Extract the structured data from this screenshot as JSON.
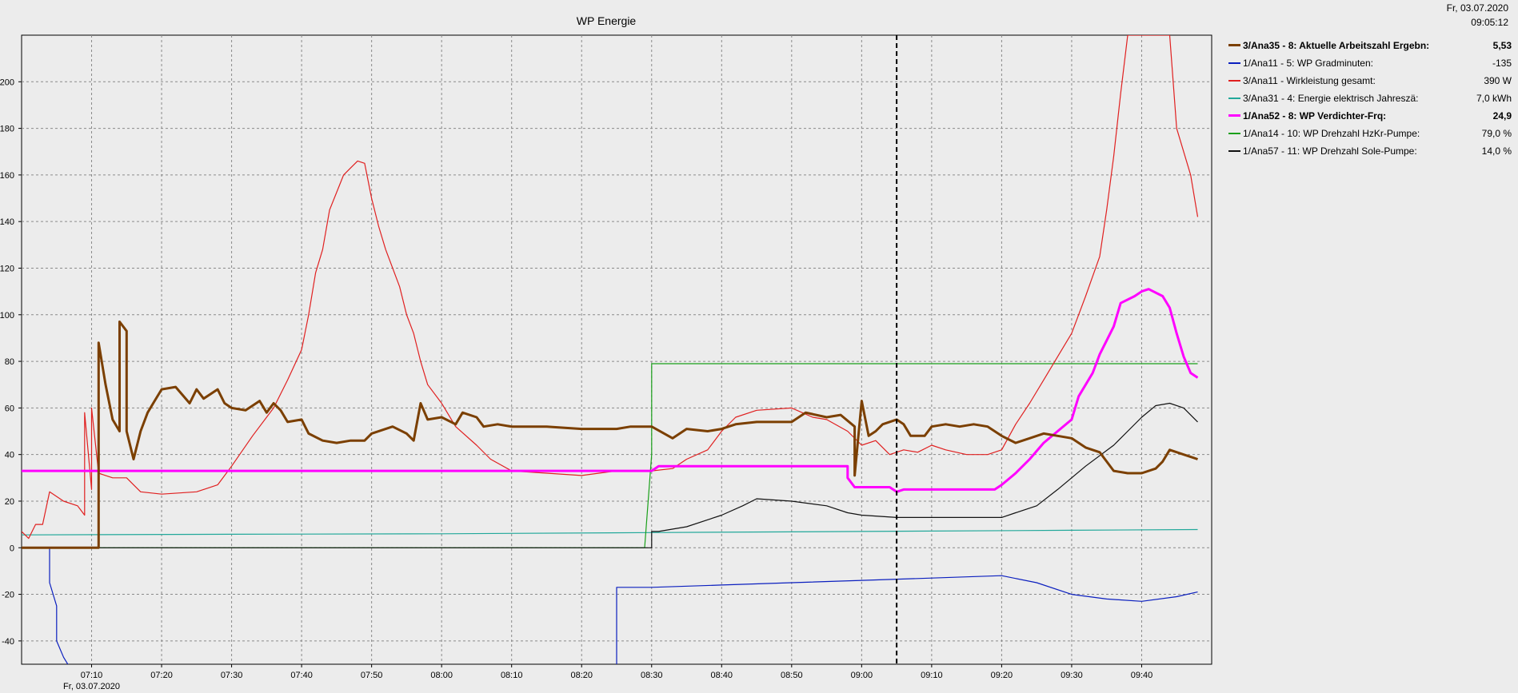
{
  "header": {
    "date": "Fr, 03.07.2020",
    "time": "09:05:12"
  },
  "chart_data": {
    "type": "line",
    "title": "WP Energie",
    "xlabel": "",
    "ylabel": "",
    "ylim": [
      -50,
      220
    ],
    "xlim": [
      "07:00",
      "09:50"
    ],
    "x_ticks": [
      "07:10",
      "07:20",
      "07:30",
      "07:40",
      "07:50",
      "08:00",
      "08:10",
      "08:20",
      "08:30",
      "08:40",
      "08:50",
      "09:00",
      "09:10",
      "09:20",
      "09:30",
      "09:40"
    ],
    "x_date_label": "Fr, 03.07.2020",
    "y_ticks": [
      -40,
      -20,
      0,
      20,
      40,
      60,
      80,
      100,
      120,
      140,
      160,
      180,
      200
    ],
    "grid": true,
    "legend_position": "right",
    "cursor_time": "09:05",
    "series": [
      {
        "name": "3/Ana35 - 8: Aktuelle Arbeitszahl Ergebn:",
        "value": "5,53",
        "color": "#7b3f00",
        "bold": true,
        "points": [
          [
            "07:00",
            0
          ],
          [
            "07:10",
            0
          ],
          [
            "07:11",
            0
          ],
          [
            "07:11",
            88
          ],
          [
            "07:12",
            70
          ],
          [
            "07:13",
            55
          ],
          [
            "07:14",
            50
          ],
          [
            "07:14",
            97
          ],
          [
            "07:15",
            93
          ],
          [
            "07:15",
            50
          ],
          [
            "07:16",
            38
          ],
          [
            "07:17",
            50
          ],
          [
            "07:18",
            58
          ],
          [
            "07:19",
            63
          ],
          [
            "07:20",
            68
          ],
          [
            "07:22",
            69
          ],
          [
            "07:24",
            62
          ],
          [
            "07:25",
            68
          ],
          [
            "07:26",
            64
          ],
          [
            "07:28",
            68
          ],
          [
            "07:29",
            62
          ],
          [
            "07:30",
            60
          ],
          [
            "07:32",
            59
          ],
          [
            "07:34",
            63
          ],
          [
            "07:35",
            58
          ],
          [
            "07:36",
            62
          ],
          [
            "07:37",
            59
          ],
          [
            "07:38",
            54
          ],
          [
            "07:40",
            55
          ],
          [
            "07:41",
            49
          ],
          [
            "07:43",
            46
          ],
          [
            "07:45",
            45
          ],
          [
            "07:47",
            46
          ],
          [
            "07:49",
            46
          ],
          [
            "07:50",
            49
          ],
          [
            "07:53",
            52
          ],
          [
            "07:55",
            49
          ],
          [
            "07:56",
            46
          ],
          [
            "07:57",
            62
          ],
          [
            "07:58",
            55
          ],
          [
            "08:00",
            56
          ],
          [
            "08:02",
            53
          ],
          [
            "08:03",
            58
          ],
          [
            "08:05",
            56
          ],
          [
            "08:06",
            52
          ],
          [
            "08:08",
            53
          ],
          [
            "08:10",
            52
          ],
          [
            "08:15",
            52
          ],
          [
            "08:20",
            51
          ],
          [
            "08:25",
            51
          ],
          [
            "08:27",
            52
          ],
          [
            "08:30",
            52
          ],
          [
            "08:33",
            47
          ],
          [
            "08:35",
            51
          ],
          [
            "08:38",
            50
          ],
          [
            "08:40",
            51
          ],
          [
            "08:42",
            53
          ],
          [
            "08:45",
            54
          ],
          [
            "08:48",
            54
          ],
          [
            "08:50",
            54
          ],
          [
            "08:52",
            58
          ],
          [
            "08:55",
            56
          ],
          [
            "08:57",
            57
          ],
          [
            "08:59",
            52
          ],
          [
            "08:59",
            31
          ],
          [
            "09:00",
            63
          ],
          [
            "09:01",
            48
          ],
          [
            "09:02",
            50
          ],
          [
            "09:03",
            53
          ],
          [
            "09:05",
            55
          ],
          [
            "09:06",
            53
          ],
          [
            "09:07",
            48
          ],
          [
            "09:09",
            48
          ],
          [
            "09:10",
            52
          ],
          [
            "09:12",
            53
          ],
          [
            "09:14",
            52
          ],
          [
            "09:16",
            53
          ],
          [
            "09:18",
            52
          ],
          [
            "09:20",
            48
          ],
          [
            "09:22",
            45
          ],
          [
            "09:24",
            47
          ],
          [
            "09:26",
            49
          ],
          [
            "09:28",
            48
          ],
          [
            "09:30",
            47
          ],
          [
            "09:32",
            43
          ],
          [
            "09:34",
            41
          ],
          [
            "09:35",
            37
          ],
          [
            "09:36",
            33
          ],
          [
            "09:38",
            32
          ],
          [
            "09:40",
            32
          ],
          [
            "09:42",
            34
          ],
          [
            "09:43",
            37
          ],
          [
            "09:44",
            42
          ],
          [
            "09:46",
            40
          ],
          [
            "09:47",
            39
          ],
          [
            "09:48",
            38
          ]
        ]
      },
      {
        "name": "1/Ana11 - 5: WP Gradminuten:",
        "value": "-135",
        "color": "#0b1fbf",
        "bold": false,
        "points": [
          [
            "07:00",
            0
          ],
          [
            "07:04",
            0
          ],
          [
            "07:04",
            -15
          ],
          [
            "07:05",
            -25
          ],
          [
            "07:05",
            -40
          ],
          [
            "07:06",
            -47
          ],
          [
            "07:07",
            -52
          ],
          [
            "08:25",
            -52
          ],
          [
            "08:25",
            -17
          ],
          [
            "08:30",
            -17
          ],
          [
            "08:40",
            -16
          ],
          [
            "08:50",
            -15
          ],
          [
            "09:00",
            -14
          ],
          [
            "09:10",
            -13
          ],
          [
            "09:20",
            -12
          ],
          [
            "09:25",
            -15
          ],
          [
            "09:30",
            -20
          ],
          [
            "09:35",
            -22
          ],
          [
            "09:40",
            -23
          ],
          [
            "09:45",
            -21
          ],
          [
            "09:48",
            -19
          ]
        ]
      },
      {
        "name": "3/Ana11 - Wirkleistung gesamt:",
        "value": "390 W",
        "color": "#e02020",
        "bold": false,
        "points": [
          [
            "07:00",
            7
          ],
          [
            "07:01",
            4
          ],
          [
            "07:02",
            10
          ],
          [
            "07:03",
            10
          ],
          [
            "07:04",
            24
          ],
          [
            "07:06",
            20
          ],
          [
            "07:08",
            18
          ],
          [
            "07:09",
            14
          ],
          [
            "07:09",
            58
          ],
          [
            "07:10",
            25
          ],
          [
            "07:10",
            60
          ],
          [
            "07:11",
            32
          ],
          [
            "07:13",
            30
          ],
          [
            "07:15",
            30
          ],
          [
            "07:16",
            27
          ],
          [
            "07:17",
            24
          ],
          [
            "07:20",
            23
          ],
          [
            "07:25",
            24
          ],
          [
            "07:28",
            27
          ],
          [
            "07:30",
            35
          ],
          [
            "07:33",
            48
          ],
          [
            "07:36",
            60
          ],
          [
            "07:38",
            72
          ],
          [
            "07:40",
            85
          ],
          [
            "07:41",
            100
          ],
          [
            "07:42",
            118
          ],
          [
            "07:43",
            128
          ],
          [
            "07:44",
            145
          ],
          [
            "07:46",
            160
          ],
          [
            "07:47",
            163
          ],
          [
            "07:48",
            166
          ],
          [
            "07:49",
            165
          ],
          [
            "07:50",
            150
          ],
          [
            "07:51",
            138
          ],
          [
            "07:52",
            128
          ],
          [
            "07:54",
            112
          ],
          [
            "07:55",
            100
          ],
          [
            "07:56",
            92
          ],
          [
            "07:57",
            80
          ],
          [
            "07:58",
            70
          ],
          [
            "08:00",
            62
          ],
          [
            "08:02",
            52
          ],
          [
            "08:05",
            44
          ],
          [
            "08:07",
            38
          ],
          [
            "08:10",
            33
          ],
          [
            "08:15",
            32
          ],
          [
            "08:20",
            31
          ],
          [
            "08:25",
            33
          ],
          [
            "08:30",
            33
          ],
          [
            "08:33",
            34
          ],
          [
            "08:35",
            38
          ],
          [
            "08:38",
            42
          ],
          [
            "08:40",
            50
          ],
          [
            "08:42",
            56
          ],
          [
            "08:45",
            59
          ],
          [
            "08:50",
            60
          ],
          [
            "08:53",
            56
          ],
          [
            "08:55",
            55
          ],
          [
            "08:58",
            50
          ],
          [
            "09:00",
            44
          ],
          [
            "09:02",
            46
          ],
          [
            "09:04",
            40
          ],
          [
            "09:06",
            42
          ],
          [
            "09:08",
            41
          ],
          [
            "09:10",
            44
          ],
          [
            "09:12",
            42
          ],
          [
            "09:15",
            40
          ],
          [
            "09:18",
            40
          ],
          [
            "09:20",
            42
          ],
          [
            "09:22",
            53
          ],
          [
            "09:24",
            62
          ],
          [
            "09:26",
            72
          ],
          [
            "09:28",
            82
          ],
          [
            "09:30",
            92
          ],
          [
            "09:32",
            108
          ],
          [
            "09:34",
            125
          ],
          [
            "09:35",
            145
          ],
          [
            "09:36",
            168
          ],
          [
            "09:37",
            195
          ],
          [
            "09:38",
            220
          ],
          [
            "09:44",
            220
          ],
          [
            "09:45",
            180
          ],
          [
            "09:47",
            160
          ],
          [
            "09:48",
            142
          ]
        ]
      },
      {
        "name": "3/Ana31 - 4: Energie elektrisch Jahreszä:",
        "value": "7,0 kWh",
        "color": "#22a89a",
        "bold": false,
        "points": [
          [
            "07:00",
            5.5
          ],
          [
            "07:30",
            5.8
          ],
          [
            "08:00",
            6.0
          ],
          [
            "08:30",
            6.5
          ],
          [
            "09:00",
            7.0
          ],
          [
            "09:30",
            7.5
          ],
          [
            "09:48",
            7.8
          ]
        ]
      },
      {
        "name": "1/Ana52 - 8: WP Verdichter-Frq:",
        "value": "24,9",
        "color": "#ff00ff",
        "bold": true,
        "points": [
          [
            "07:00",
            33
          ],
          [
            "08:30",
            33
          ],
          [
            "08:31",
            35
          ],
          [
            "08:58",
            35
          ],
          [
            "08:58",
            30
          ],
          [
            "08:59",
            26
          ],
          [
            "09:04",
            26
          ],
          [
            "09:05",
            24
          ],
          [
            "09:06",
            25
          ],
          [
            "09:15",
            25
          ],
          [
            "09:19",
            25
          ],
          [
            "09:20",
            27
          ],
          [
            "09:22",
            32
          ],
          [
            "09:24",
            38
          ],
          [
            "09:26",
            45
          ],
          [
            "09:28",
            50
          ],
          [
            "09:30",
            55
          ],
          [
            "09:31",
            65
          ],
          [
            "09:33",
            75
          ],
          [
            "09:34",
            83
          ],
          [
            "09:36",
            95
          ],
          [
            "09:37",
            105
          ],
          [
            "09:39",
            108
          ],
          [
            "09:40",
            110
          ],
          [
            "09:41",
            111
          ],
          [
            "09:43",
            108
          ],
          [
            "09:44",
            103
          ],
          [
            "09:45",
            92
          ],
          [
            "09:46",
            82
          ],
          [
            "09:47",
            75
          ],
          [
            "09:48",
            73
          ]
        ]
      },
      {
        "name": "1/Ana14 - 10: WP Drehzahl HzKr-Pumpe:",
        "value": "79,0 %",
        "color": "#1aa01a",
        "bold": false,
        "points": [
          [
            "07:00",
            0
          ],
          [
            "08:29",
            0
          ],
          [
            "08:30",
            40
          ],
          [
            "08:30",
            79
          ],
          [
            "09:48",
            79
          ]
        ]
      },
      {
        "name": "1/Ana57 - 11: WP Drehzahl Sole-Pumpe:",
        "value": "14,0 %",
        "color": "#111111",
        "bold": false,
        "points": [
          [
            "07:00",
            0
          ],
          [
            "08:30",
            0
          ],
          [
            "08:30",
            7
          ],
          [
            "08:31",
            7
          ],
          [
            "08:35",
            9
          ],
          [
            "08:38",
            12
          ],
          [
            "08:40",
            14
          ],
          [
            "08:43",
            18
          ],
          [
            "08:45",
            21
          ],
          [
            "08:50",
            20
          ],
          [
            "08:55",
            18
          ],
          [
            "08:58",
            15
          ],
          [
            "09:00",
            14
          ],
          [
            "09:05",
            13
          ],
          [
            "09:10",
            13
          ],
          [
            "09:15",
            13
          ],
          [
            "09:20",
            13
          ],
          [
            "09:22",
            15
          ],
          [
            "09:25",
            18
          ],
          [
            "09:28",
            25
          ],
          [
            "09:32",
            35
          ],
          [
            "09:36",
            44
          ],
          [
            "09:38",
            50
          ],
          [
            "09:40",
            56
          ],
          [
            "09:42",
            61
          ],
          [
            "09:44",
            62
          ],
          [
            "09:46",
            60
          ],
          [
            "09:48",
            54
          ]
        ]
      }
    ]
  }
}
